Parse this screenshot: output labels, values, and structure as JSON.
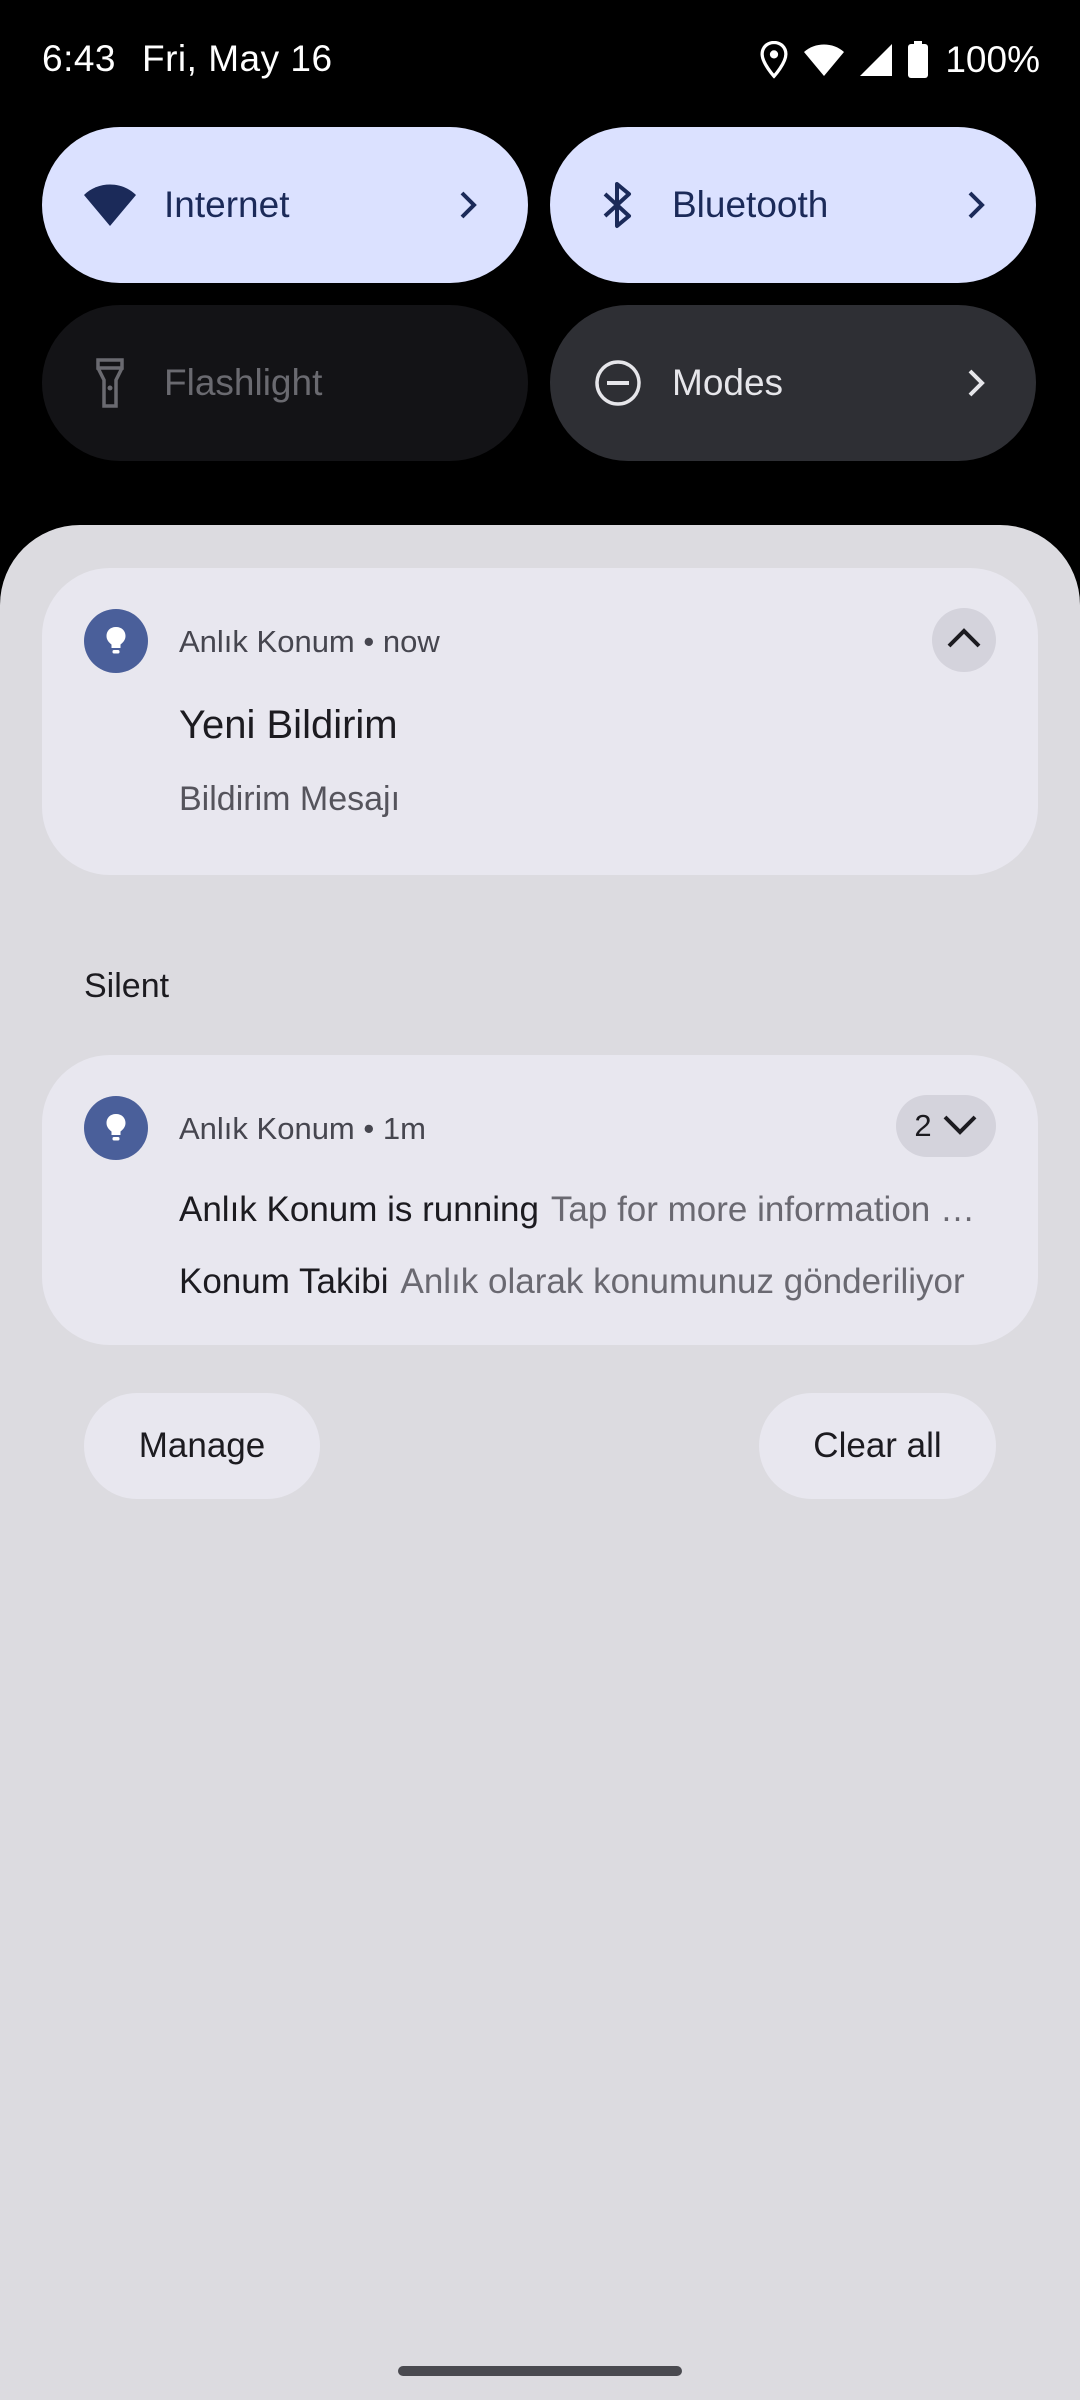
{
  "status_bar": {
    "time": "6:43",
    "date": "Fri, May 16",
    "battery": "100%",
    "icons": [
      "location-icon",
      "wifi-icon",
      "cell-signal-icon",
      "battery-icon"
    ]
  },
  "quick_settings": {
    "tiles": [
      {
        "label": "Internet",
        "icon": "wifi-icon",
        "state": "on"
      },
      {
        "label": "Bluetooth",
        "icon": "bluetooth-icon",
        "state": "on"
      },
      {
        "label": "Flashlight",
        "icon": "flashlight-icon",
        "state": "off"
      },
      {
        "label": "Modes",
        "icon": "do-not-disturb-icon",
        "state": "off"
      }
    ]
  },
  "notifications": {
    "expanded": {
      "app_name": "Anlık Konum",
      "time": "now",
      "header": "Anlık Konum • now",
      "title": "Yeni Bildirim",
      "message": "Bildirim Mesajı"
    },
    "silent_label": "Silent",
    "grouped": {
      "app_name": "Anlık Konum",
      "time": "1m",
      "header": "Anlık Konum • 1m",
      "count": "2",
      "rows": [
        {
          "sender": "Anlık Konum is running",
          "text": "Tap for more information or to stop the app."
        },
        {
          "sender": "Konum Takibi",
          "text": "Anlık olarak konumunuz gönderiliyor"
        }
      ]
    }
  },
  "actions": {
    "manage_label": "Manage",
    "clear_all_label": "Clear all"
  },
  "colors": {
    "tile_on": "#dbe1ff",
    "tile_off": "#131316",
    "shade_bg": "#dcdbe0",
    "card_bg": "#e8e7ef",
    "app_icon": "#4a5f9a"
  }
}
